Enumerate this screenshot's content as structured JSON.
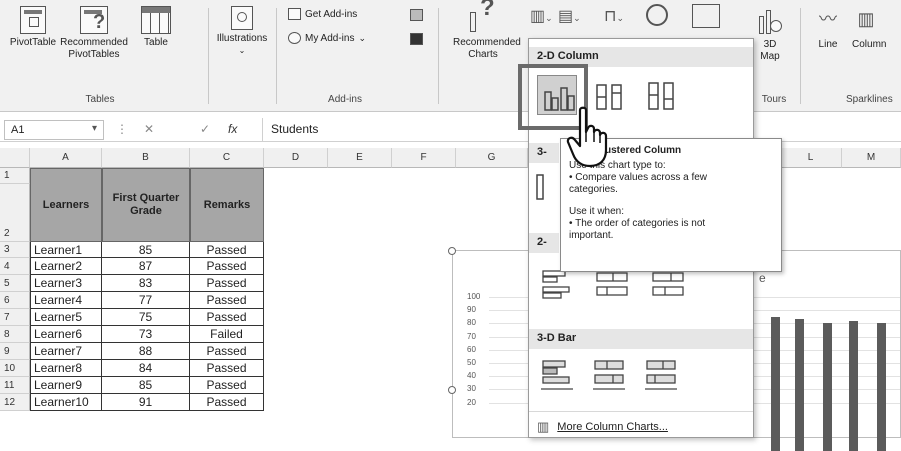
{
  "ribbon": {
    "tables_group": {
      "label": "Tables",
      "pivot": "PivotTable",
      "recommended_pivot": "Recommended PivotTables",
      "table": "Table"
    },
    "illustrations": "Illustrations",
    "addins_group": {
      "label": "Add-ins",
      "get_addins": "Get Add-ins",
      "my_addins": "My Add-ins"
    },
    "recommended_charts": "Recommended Charts",
    "tours_group": {
      "label": "Tours",
      "map3d_line1": "3D",
      "map3d_line2": "Map"
    },
    "sparklines_group": {
      "label": "Sparklines",
      "line": "Line",
      "column": "Column"
    }
  },
  "formula_bar": {
    "cell_ref": "A1",
    "fx": "fx",
    "content": "Students"
  },
  "columns": [
    "A",
    "B",
    "C",
    "D",
    "E",
    "F",
    "G",
    "",
    "L",
    "M"
  ],
  "table": {
    "headers": [
      "Learners",
      "First Quarter Grade",
      "Remarks"
    ],
    "rows": [
      [
        "Learner1",
        "85",
        "Passed"
      ],
      [
        "Learner2",
        "87",
        "Passed"
      ],
      [
        "Learner3",
        "83",
        "Passed"
      ],
      [
        "Learner4",
        "77",
        "Passed"
      ],
      [
        "Learner5",
        "75",
        "Passed"
      ],
      [
        "Learner6",
        "73",
        "Failed"
      ],
      [
        "Learner7",
        "88",
        "Passed"
      ],
      [
        "Learner8",
        "84",
        "Passed"
      ],
      [
        "Learner9",
        "85",
        "Passed"
      ],
      [
        "Learner10",
        "91",
        "Passed"
      ]
    ]
  },
  "row_numbers": [
    "1",
    "2",
    "3",
    "4",
    "5",
    "6",
    "7",
    "8",
    "9",
    "10",
    "11",
    "12"
  ],
  "dropdown": {
    "section_2d_column": "2-D Column",
    "section_3d_prefix": "3-",
    "section_2d_bar_prefix": "2-",
    "section_3d_bar": "3-D Bar",
    "more": "More Column Charts..."
  },
  "tooltip": {
    "title": "Clustered Column",
    "use_to": "Use this chart type to:",
    "bullet1_a": "• Compare values across a few",
    "bullet1_b": "categories.",
    "use_when": "Use it when:",
    "bullet2_a": "• The order of categories is not",
    "bullet2_b": "important."
  },
  "chart": {
    "y_ticks": [
      "100",
      "90",
      "80",
      "70",
      "60",
      "50",
      "40",
      "30",
      "20"
    ],
    "title_fragment": "e"
  },
  "chart_data": {
    "type": "bar",
    "visible_values": [
      85,
      83,
      80,
      82,
      80
    ],
    "ylim": [
      20,
      100
    ]
  },
  "colors": {
    "ribbon_bg": "#f1f1f1",
    "header_cell": "#a6a6a6",
    "bar": "#5b5b5b"
  }
}
